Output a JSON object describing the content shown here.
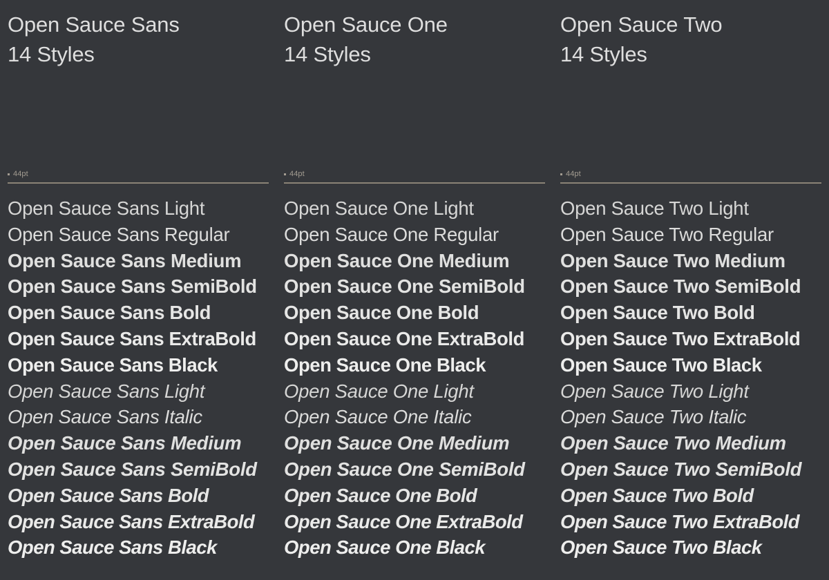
{
  "background_color": "#35373b",
  "text_color": "#e2e2e1",
  "rule_color": "#8b8376",
  "size_label_color": "#a39c91",
  "columns": [
    {
      "family_name": "Open Sauce Sans",
      "styles_count_label": "14 Styles",
      "size_label": "44pt",
      "styles": [
        {
          "label": "Open Sauce Sans Light",
          "weight": "light",
          "italic": false
        },
        {
          "label": "Open Sauce Sans Regular",
          "weight": "regular",
          "italic": false
        },
        {
          "label": "Open Sauce Sans Medium",
          "weight": "medium",
          "italic": false
        },
        {
          "label": "Open Sauce Sans SemiBold",
          "weight": "semibold",
          "italic": false
        },
        {
          "label": "Open Sauce Sans Bold",
          "weight": "bold",
          "italic": false
        },
        {
          "label": "Open Sauce Sans ExtraBold",
          "weight": "extrabold",
          "italic": false
        },
        {
          "label": "Open Sauce Sans Black",
          "weight": "black",
          "italic": false
        },
        {
          "label": "Open Sauce Sans Light",
          "weight": "light",
          "italic": true
        },
        {
          "label": "Open Sauce Sans Italic",
          "weight": "regular",
          "italic": true
        },
        {
          "label": "Open Sauce Sans Medium",
          "weight": "medium",
          "italic": true
        },
        {
          "label": "Open Sauce Sans SemiBold",
          "weight": "semibold",
          "italic": true
        },
        {
          "label": "Open Sauce Sans Bold",
          "weight": "bold",
          "italic": true
        },
        {
          "label": "Open Sauce Sans ExtraBold",
          "weight": "extrabold",
          "italic": true
        },
        {
          "label": "Open Sauce Sans Black",
          "weight": "black",
          "italic": true
        }
      ]
    },
    {
      "family_name": "Open Sauce One",
      "styles_count_label": "14 Styles",
      "size_label": "44pt",
      "styles": [
        {
          "label": "Open Sauce One Light",
          "weight": "light",
          "italic": false
        },
        {
          "label": "Open Sauce One Regular",
          "weight": "regular",
          "italic": false
        },
        {
          "label": "Open Sauce One Medium",
          "weight": "medium",
          "italic": false
        },
        {
          "label": "Open Sauce One SemiBold",
          "weight": "semibold",
          "italic": false
        },
        {
          "label": "Open Sauce One Bold",
          "weight": "bold",
          "italic": false
        },
        {
          "label": "Open Sauce One ExtraBold",
          "weight": "extrabold",
          "italic": false
        },
        {
          "label": "Open Sauce One Black",
          "weight": "black",
          "italic": false
        },
        {
          "label": "Open Sauce One Light",
          "weight": "light",
          "italic": true
        },
        {
          "label": "Open Sauce One Italic",
          "weight": "regular",
          "italic": true
        },
        {
          "label": "Open Sauce One Medium",
          "weight": "medium",
          "italic": true
        },
        {
          "label": "Open Sauce One SemiBold",
          "weight": "semibold",
          "italic": true
        },
        {
          "label": "Open Sauce One Bold",
          "weight": "bold",
          "italic": true
        },
        {
          "label": "Open Sauce One ExtraBold",
          "weight": "extrabold",
          "italic": true
        },
        {
          "label": "Open Sauce One Black",
          "weight": "black",
          "italic": true
        }
      ]
    },
    {
      "family_name": "Open Sauce Two",
      "styles_count_label": "14 Styles",
      "size_label": "44pt",
      "styles": [
        {
          "label": "Open Sauce Two Light",
          "weight": "light",
          "italic": false
        },
        {
          "label": "Open Sauce Two Regular",
          "weight": "regular",
          "italic": false
        },
        {
          "label": "Open Sauce Two Medium",
          "weight": "medium",
          "italic": false
        },
        {
          "label": "Open Sauce Two SemiBold",
          "weight": "semibold",
          "italic": false
        },
        {
          "label": "Open Sauce Two Bold",
          "weight": "bold",
          "italic": false
        },
        {
          "label": "Open Sauce Two ExtraBold",
          "weight": "extrabold",
          "italic": false
        },
        {
          "label": "Open Sauce Two Black",
          "weight": "black",
          "italic": false
        },
        {
          "label": "Open Sauce Two Light",
          "weight": "light",
          "italic": true
        },
        {
          "label": "Open Sauce Two Italic",
          "weight": "regular",
          "italic": true
        },
        {
          "label": "Open Sauce Two Medium",
          "weight": "medium",
          "italic": true
        },
        {
          "label": "Open Sauce Two SemiBold",
          "weight": "semibold",
          "italic": true
        },
        {
          "label": "Open Sauce Two Bold",
          "weight": "bold",
          "italic": true
        },
        {
          "label": "Open Sauce Two ExtraBold",
          "weight": "extrabold",
          "italic": true
        },
        {
          "label": "Open Sauce Two Black",
          "weight": "black",
          "italic": true
        }
      ]
    }
  ]
}
